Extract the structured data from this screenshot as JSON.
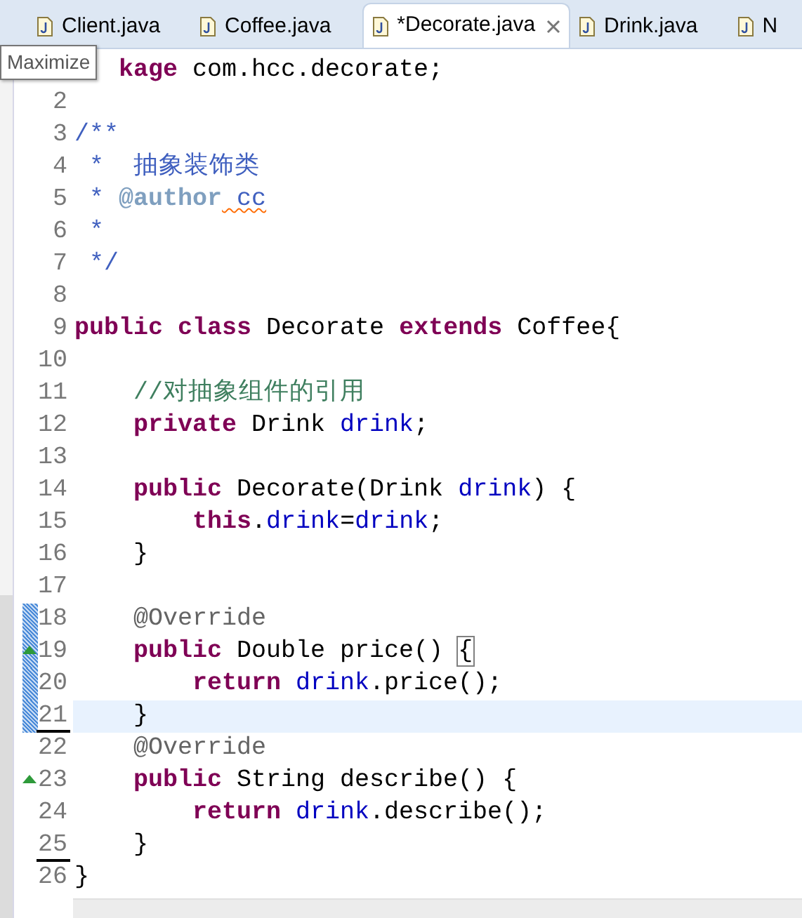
{
  "tabs": [
    {
      "label": "Client.java",
      "selected": false,
      "closable": false
    },
    {
      "label": "Coffee.java",
      "selected": false,
      "closable": false
    },
    {
      "label": "*Decorate.java",
      "selected": true,
      "closable": true
    },
    {
      "label": "Drink.java",
      "selected": false,
      "closable": false
    },
    {
      "label": "N",
      "selected": false,
      "closable": false
    }
  ],
  "tooltip": "Maximize",
  "editor": {
    "lines": [
      {
        "current": false,
        "override": false,
        "changed": false,
        "underlined": false,
        "tokens": [
          {
            "kind": "keyword",
            "text": "kage"
          },
          {
            "kind": "plain",
            "text": " com.hcc.decorate;"
          }
        ]
      },
      {
        "number": "2",
        "current": false,
        "override": false,
        "changed": false,
        "underlined": false
      },
      {
        "number": "3",
        "current": false,
        "override": false,
        "changed": false,
        "underlined": false,
        "tokens": [
          {
            "kind": "doc",
            "text": "/**"
          }
        ]
      },
      {
        "number": "4",
        "current": false,
        "override": false,
        "changed": false,
        "underlined": false,
        "tokens": [
          {
            "kind": "doc",
            "text": " *  抽象装饰类"
          }
        ]
      },
      {
        "number": "5",
        "current": false,
        "override": false,
        "changed": false,
        "underlined": false,
        "tokens": [
          {
            "kind": "doc",
            "text": " * "
          },
          {
            "kind": "doctag",
            "text": "@author"
          },
          {
            "kind": "misspelled",
            "text": " cc"
          }
        ]
      },
      {
        "number": "6",
        "current": false,
        "override": false,
        "changed": false,
        "underlined": false,
        "tokens": [
          {
            "kind": "doc",
            "text": " *"
          }
        ]
      },
      {
        "number": "7",
        "current": false,
        "override": false,
        "changed": false,
        "underlined": false,
        "tokens": [
          {
            "kind": "doc",
            "text": " */"
          }
        ]
      },
      {
        "number": "8",
        "current": false,
        "override": false,
        "changed": false,
        "underlined": false
      },
      {
        "number": "9",
        "current": false,
        "override": false,
        "changed": false,
        "underlined": false,
        "tokens": [
          {
            "kind": "keyword",
            "text": "public class"
          },
          {
            "kind": "plain",
            "text": " Decorate "
          },
          {
            "kind": "keyword",
            "text": "extends"
          },
          {
            "kind": "plain",
            "text": " Coffee{"
          }
        ]
      },
      {
        "number": "10",
        "current": false,
        "override": false,
        "changed": false,
        "underlined": false
      },
      {
        "number": "11",
        "current": false,
        "override": false,
        "changed": false,
        "underlined": false,
        "tokens": [
          {
            "kind": "comment",
            "text": "    //对抽象组件的引用"
          }
        ]
      },
      {
        "number": "12",
        "current": false,
        "override": false,
        "changed": false,
        "underlined": false,
        "tokens": [
          {
            "kind": "keyword",
            "text": "    private"
          },
          {
            "kind": "plain",
            "text": " Drink "
          },
          {
            "kind": "field",
            "text": "drink"
          },
          {
            "kind": "plain",
            "text": ";"
          }
        ]
      },
      {
        "number": "13",
        "current": false,
        "override": false,
        "changed": false,
        "underlined": false
      },
      {
        "number": "14",
        "current": false,
        "override": false,
        "changed": false,
        "underlined": false,
        "tokens": [
          {
            "kind": "keyword",
            "text": "    public"
          },
          {
            "kind": "plain",
            "text": " Decorate(Drink "
          },
          {
            "kind": "param",
            "text": "drink"
          },
          {
            "kind": "plain",
            "text": ") {"
          }
        ]
      },
      {
        "number": "15",
        "current": false,
        "override": false,
        "changed": false,
        "underlined": false,
        "tokens": [
          {
            "kind": "keyword",
            "text": "        this"
          },
          {
            "kind": "plain",
            "text": "."
          },
          {
            "kind": "field",
            "text": "drink"
          },
          {
            "kind": "plain",
            "text": "="
          },
          {
            "kind": "param",
            "text": "drink"
          },
          {
            "kind": "plain",
            "text": ";"
          }
        ]
      },
      {
        "number": "16",
        "current": false,
        "override": false,
        "changed": false,
        "underlined": false,
        "tokens": [
          {
            "kind": "plain",
            "text": "    }"
          }
        ]
      },
      {
        "number": "17",
        "current": false,
        "override": false,
        "changed": false,
        "underlined": false
      },
      {
        "number": "18",
        "current": false,
        "override": false,
        "changed": true,
        "underlined": false,
        "tokens": [
          {
            "kind": "annotation",
            "text": "    @Override"
          }
        ]
      },
      {
        "number": "19",
        "current": false,
        "override": true,
        "changed": true,
        "underlined": false,
        "tokens": [
          {
            "kind": "keyword",
            "text": "    public"
          },
          {
            "kind": "plain",
            "text": " Double price() "
          },
          {
            "kind": "bracket",
            "text": "{"
          }
        ]
      },
      {
        "number": "20",
        "current": false,
        "override": false,
        "changed": true,
        "underlined": false,
        "tokens": [
          {
            "kind": "keyword",
            "text": "        return"
          },
          {
            "kind": "field",
            "text": " drink"
          },
          {
            "kind": "plain",
            "text": ".price();"
          }
        ]
      },
      {
        "number": "21",
        "current": true,
        "override": false,
        "changed": true,
        "underlined": true,
        "tokens": [
          {
            "kind": "plain",
            "text": "    }"
          }
        ]
      },
      {
        "number": "22",
        "current": false,
        "override": false,
        "changed": false,
        "underlined": false,
        "tokens": [
          {
            "kind": "annotation",
            "text": "    @Override"
          }
        ]
      },
      {
        "number": "23",
        "current": false,
        "override": true,
        "changed": false,
        "underlined": false,
        "tokens": [
          {
            "kind": "keyword",
            "text": "    public"
          },
          {
            "kind": "plain",
            "text": " String describe() {"
          }
        ]
      },
      {
        "number": "24",
        "current": false,
        "override": false,
        "changed": false,
        "underlined": false,
        "tokens": [
          {
            "kind": "keyword",
            "text": "        return"
          },
          {
            "kind": "field",
            "text": " drink"
          },
          {
            "kind": "plain",
            "text": ".describe();"
          }
        ]
      },
      {
        "number": "25",
        "current": false,
        "override": false,
        "changed": false,
        "underlined": true,
        "tokens": [
          {
            "kind": "plain",
            "text": "    }"
          }
        ]
      },
      {
        "number": "26",
        "current": false,
        "override": false,
        "changed": false,
        "underlined": false,
        "tokens": [
          {
            "kind": "plain",
            "text": "}"
          }
        ]
      }
    ]
  }
}
